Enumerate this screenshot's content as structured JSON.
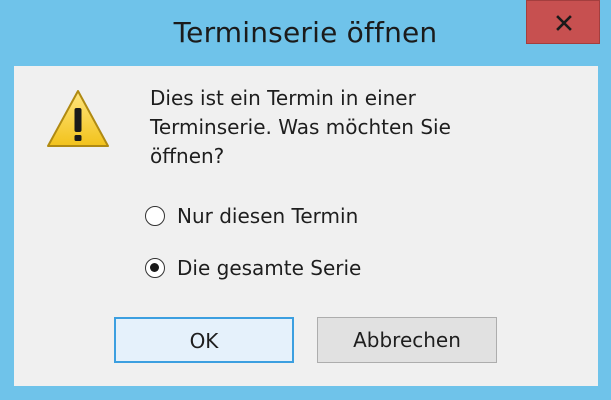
{
  "window": {
    "title": "Terminserie öffnen",
    "close_icon": "close-icon",
    "accent_color": "#6fc3ea",
    "close_color": "#c75050"
  },
  "dialog": {
    "icon": "warning-icon",
    "message": "Dies ist ein Termin in einer\nTerminserie. Was möchten Sie\nöffnen?",
    "options": [
      {
        "label": "Nur diesen Termin",
        "selected": false
      },
      {
        "label": "Die gesamte Serie",
        "selected": true
      }
    ],
    "buttons": {
      "ok_label": "OK",
      "cancel_label": "Abbrechen"
    }
  }
}
